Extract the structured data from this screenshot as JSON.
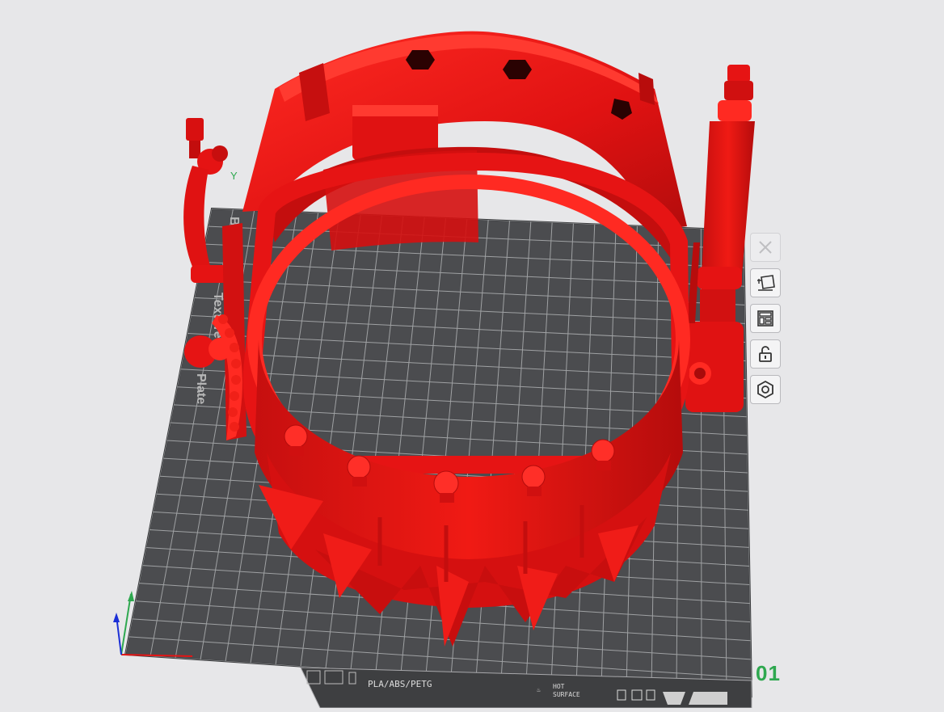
{
  "app": {
    "view": "3d-prepare"
  },
  "build_plate": {
    "side_label_1": "Bambu",
    "side_label_2": "Texture",
    "side_label_3": "Plate",
    "filament_types": "PLA/ABS/PETG",
    "hot_surface_line1": "HOT",
    "hot_surface_line2": "SURFACE",
    "plate_number": "01"
  },
  "axes": {
    "y_label": "Y",
    "z_label": "Z"
  },
  "toolbar": {
    "buttons": [
      {
        "name": "delete-plate",
        "icon": "close-icon",
        "enabled": false
      },
      {
        "name": "auto-orient",
        "icon": "orient-icon",
        "enabled": true
      },
      {
        "name": "arrange",
        "icon": "arrange-icon",
        "enabled": true
      },
      {
        "name": "lock-plate",
        "icon": "lock-icon",
        "enabled": true
      },
      {
        "name": "plate-settings",
        "icon": "hexagon-nut-icon",
        "enabled": true
      }
    ]
  },
  "colors": {
    "model": "#e61414",
    "plate": "#4b4c4f",
    "grid": "#9fa1a3",
    "plate_index": "#2ea84f",
    "background": "#e7e7e9"
  }
}
